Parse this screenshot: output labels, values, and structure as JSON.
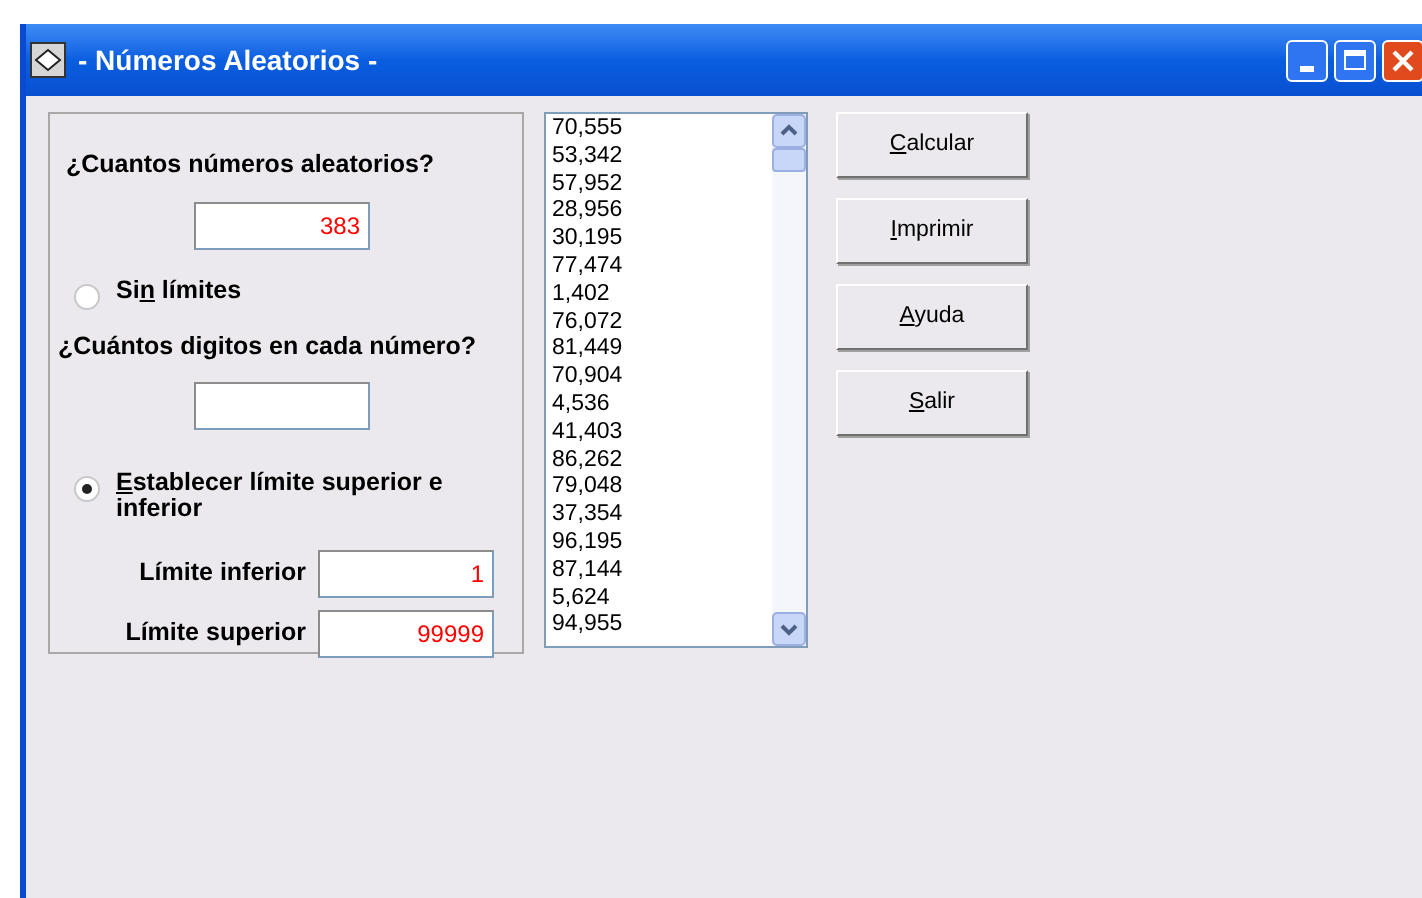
{
  "window": {
    "title": "- Números Aleatorios -"
  },
  "form": {
    "count_label": "¿Cuantos números aleatorios?",
    "count_value": "383",
    "options": [
      {
        "kind": "radio",
        "parts": {
          "pre": "Si",
          "key": "n",
          "post": " límites"
        },
        "selected": false
      },
      {
        "kind": "question",
        "text": "¿Cuántos digitos en cada número?"
      },
      {
        "kind": "radio",
        "parts": {
          "key": "E",
          "post": "stablecer límite superior e inferior"
        },
        "selected": true
      }
    ],
    "limits": [
      {
        "label": "Límite inferior",
        "value": "1"
      },
      {
        "label": "Límite superior",
        "value": "99999"
      }
    ]
  },
  "results": [
    "70,555",
    "53,342",
    "57,952",
    "28,956",
    "30,195",
    "77,474",
    "1,402",
    "76,072",
    "81,449",
    "70,904",
    "4,536",
    "41,403",
    "86,262",
    "79,048",
    "37,354",
    "96,195",
    "87,144",
    "5,624",
    "94,955"
  ],
  "buttons": [
    {
      "key": "C",
      "post": "alcular"
    },
    {
      "key": "I",
      "post": "mprimir"
    },
    {
      "key": "A",
      "post": "yuda"
    },
    {
      "key": "S",
      "post": "alir"
    }
  ]
}
